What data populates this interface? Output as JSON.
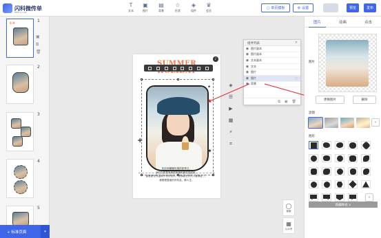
{
  "app": {
    "logo_text": "闪科微传单",
    "logo_sub": "NEW & LAB"
  },
  "toolbar": {
    "items": [
      {
        "label": "文本",
        "icon": "text-icon",
        "glyph": "T"
      },
      {
        "label": "图片",
        "icon": "image-icon",
        "glyph": "▣"
      },
      {
        "label": "背景",
        "icon": "background-icon",
        "glyph": "▤"
      },
      {
        "label": "形状",
        "icon": "shape-icon",
        "glyph": "☆"
      },
      {
        "label": "组件",
        "icon": "component-icon",
        "glyph": "◈"
      },
      {
        "label": "会员",
        "icon": "vip-icon",
        "glyph": "♛"
      }
    ],
    "template_btn": "单页模板",
    "settings_btn": "设置",
    "btn_gray": "",
    "preview_btn": "预览",
    "publish_btn": "发布"
  },
  "pages": {
    "numbers": [
      "1",
      "2",
      "3",
      "4",
      "5"
    ],
    "add_page": "+ 标准页面",
    "add_caret": "▾"
  },
  "canvas": {
    "title_line1": "SUMMER",
    "title_line2": "HOLIDAY",
    "badge": "♪",
    "caption_lines": [
      "阳光和暖暖吹拂的夏季日，",
      "我们去那里有美丽风景和爱的感谢来。",
      "能看看世界温和不停的快乐，是我能世界的人都满足了，",
      "都看看整面的好机会，脚人生。"
    ]
  },
  "layers": {
    "title": "组件列表",
    "close": "×",
    "rows": [
      "图片副本",
      "图片副本",
      "文本副本",
      "文本",
      "图片",
      "图片",
      "背景"
    ],
    "selected_index": 5
  },
  "float_buttons": [
    {
      "label": "客服",
      "icon": "user-icon",
      "glyph": "◯"
    },
    {
      "label": "公众号",
      "icon": "qrcode-icon",
      "glyph": "▦"
    }
  ],
  "right_panel": {
    "tabs": [
      "图片",
      "动画",
      "点击"
    ],
    "active_tab": 0,
    "image_label": "图片",
    "replace_btn": "更换图片",
    "delete_btn": "删除",
    "filter_label": "滤镜",
    "shape_label": "图形",
    "more": "»",
    "more_style": "再编样式 ∨"
  }
}
